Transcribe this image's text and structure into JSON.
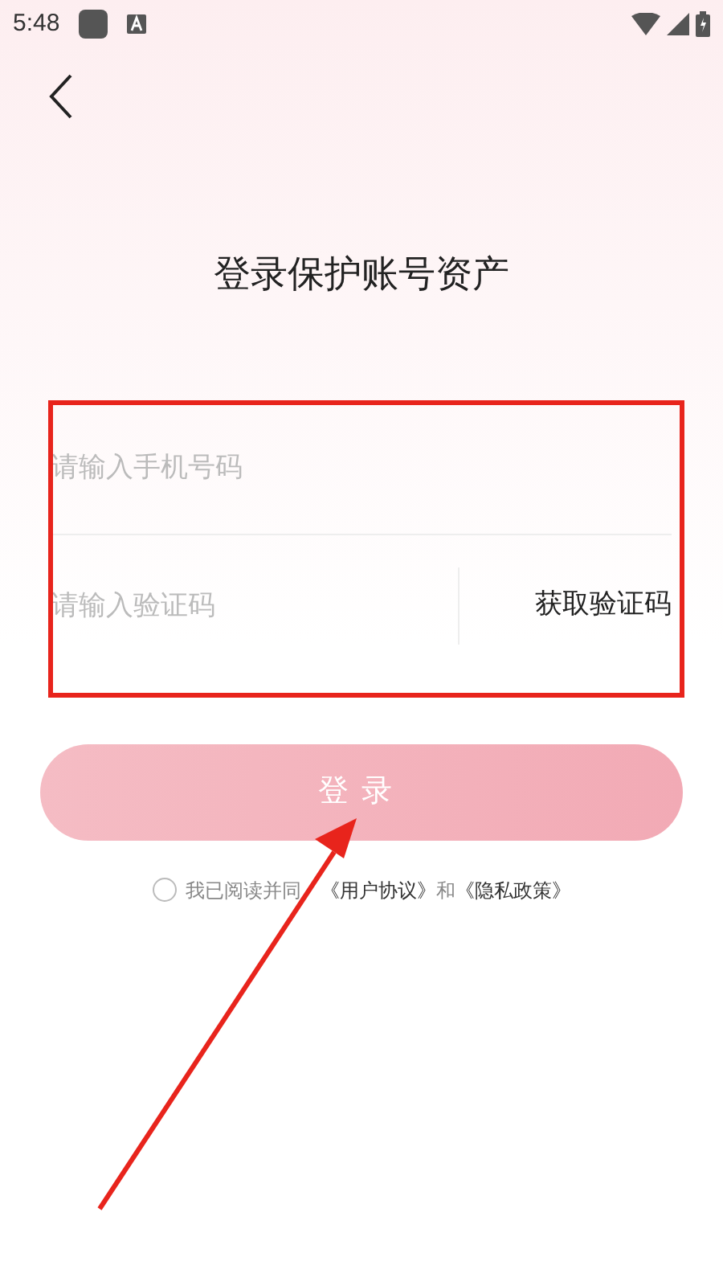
{
  "status_bar": {
    "time": "5:48"
  },
  "title": "登录保护账号资产",
  "phone_field": {
    "placeholder": "请输入手机号码"
  },
  "code_field": {
    "placeholder": "请输入验证码"
  },
  "get_code_button": "获取验证码",
  "login_button": {
    "label": "登录",
    "disabled": true
  },
  "agreement": {
    "checked": false,
    "text": "我已阅读并同",
    "link_1": "《用户协议》",
    "joiner": "和",
    "link_2": "《隐私政策》"
  }
}
